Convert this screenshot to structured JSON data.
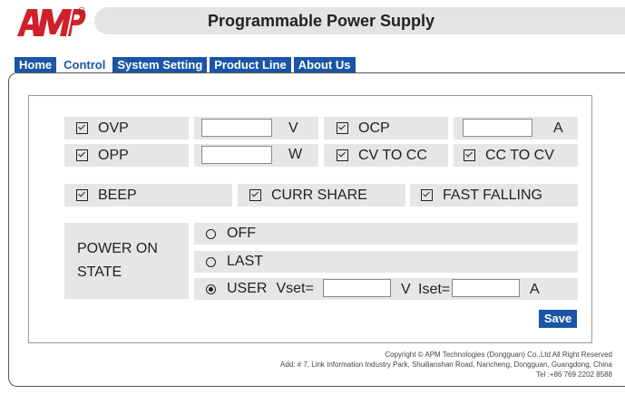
{
  "header": {
    "title": "Programmable Power Supply",
    "logo_icon": "apm-logo"
  },
  "nav": {
    "tabs": [
      {
        "label": "Home"
      },
      {
        "label": "Control",
        "active": true
      },
      {
        "label": "System Setting"
      },
      {
        "label": "Product Line"
      },
      {
        "label": "About Us"
      }
    ]
  },
  "protection": {
    "ovp": {
      "label": "OVP",
      "checked": true,
      "value": "",
      "unit": "V"
    },
    "ocp": {
      "label": "OCP",
      "checked": true,
      "value": "",
      "unit": "A"
    },
    "opp": {
      "label": "OPP",
      "checked": true,
      "value": "",
      "unit": "W"
    },
    "cv_to_cc": {
      "label": "CV TO CC",
      "checked": true
    },
    "cc_to_cv": {
      "label": "CC TO CV",
      "checked": true
    }
  },
  "options": {
    "beep": {
      "label": "BEEP",
      "checked": true
    },
    "curr_share": {
      "label": "CURR SHARE",
      "checked": true
    },
    "fast_falling": {
      "label": "FAST FALLING",
      "checked": true
    }
  },
  "power_on": {
    "label_line1": "POWER ON",
    "label_line2": "STATE",
    "off": "OFF",
    "last": "LAST",
    "user": "USER",
    "selected": "USER",
    "vset_label": "Vset=",
    "vset_value": "",
    "vset_unit": "V",
    "iset_label": "Iset=",
    "iset_value": "",
    "iset_unit": "A"
  },
  "save_label": "Save",
  "footer": {
    "line1": "Copyright © APM Technologies (Dongguan) Co.,Ltd All Right Reserved",
    "line2": "Add: # 7, Link Information Industry Park, Shuilianshan Road, Nancheng, Dongguan, Guangdong, China",
    "line3": "Tel :+86 769 2202 8588"
  },
  "colors": {
    "accent": "#1a56a5",
    "logo_red": "#d0202a",
    "cell_bg": "#e6e6e6"
  }
}
